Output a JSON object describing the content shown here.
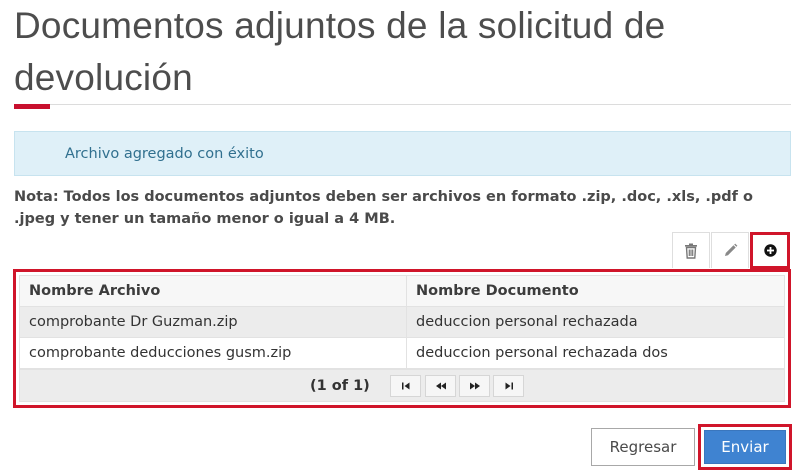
{
  "page": {
    "title": "Documentos adjuntos de la solicitud de devolución"
  },
  "alert": {
    "message": "Archivo agregado con éxito"
  },
  "note": {
    "text": "Nota: Todos los documentos adjuntos deben ser archivos en formato .zip, .doc, .xls, .pdf o .jpeg y tener un tamaño menor o igual a 4 MB."
  },
  "toolbar": {
    "icons": [
      "trash-icon",
      "pencil-icon",
      "plus-circle-icon"
    ]
  },
  "table": {
    "headers": [
      "Nombre Archivo",
      "Nombre Documento"
    ],
    "rows": [
      [
        "comprobante Dr Guzman.zip",
        "deduccion personal rechazada"
      ],
      [
        "comprobante deducciones gusm.zip",
        "deduccion personal rechazada dos"
      ]
    ]
  },
  "pager": {
    "text": "(1 of 1)",
    "icons": [
      "first-page-icon",
      "prev-page-icon",
      "next-page-icon",
      "last-page-icon"
    ]
  },
  "actions": {
    "back_label": "Regresar",
    "send_label": "Enviar"
  },
  "colors": {
    "accent_red": "#c8102e",
    "highlight_red": "#d0152a",
    "alert_bg": "#dff0f8",
    "alert_text": "#31708f",
    "primary_blue": "#3f83d1"
  }
}
